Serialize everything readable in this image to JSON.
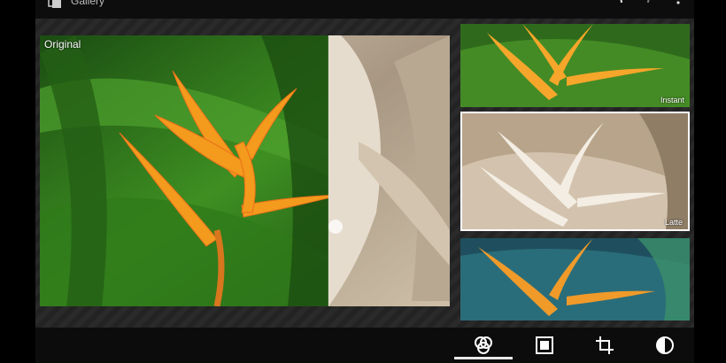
{
  "app": {
    "title": "Gallery"
  },
  "editor": {
    "compare_label": "Original"
  },
  "filters": [
    {
      "label": "Instant"
    },
    {
      "label": "Latte",
      "selected": true
    },
    {
      "label": ""
    }
  ],
  "toolbar": {
    "tools": [
      {
        "icon": "filters-icon",
        "active": true
      },
      {
        "icon": "frame-icon"
      },
      {
        "icon": "crop-icon"
      },
      {
        "icon": "adjust-icon"
      }
    ]
  },
  "colors": {
    "accent": "#e8e8e8",
    "flower": "#f5a623",
    "leaf": "#2e7d1e",
    "sepia": "#c9b9a2"
  }
}
